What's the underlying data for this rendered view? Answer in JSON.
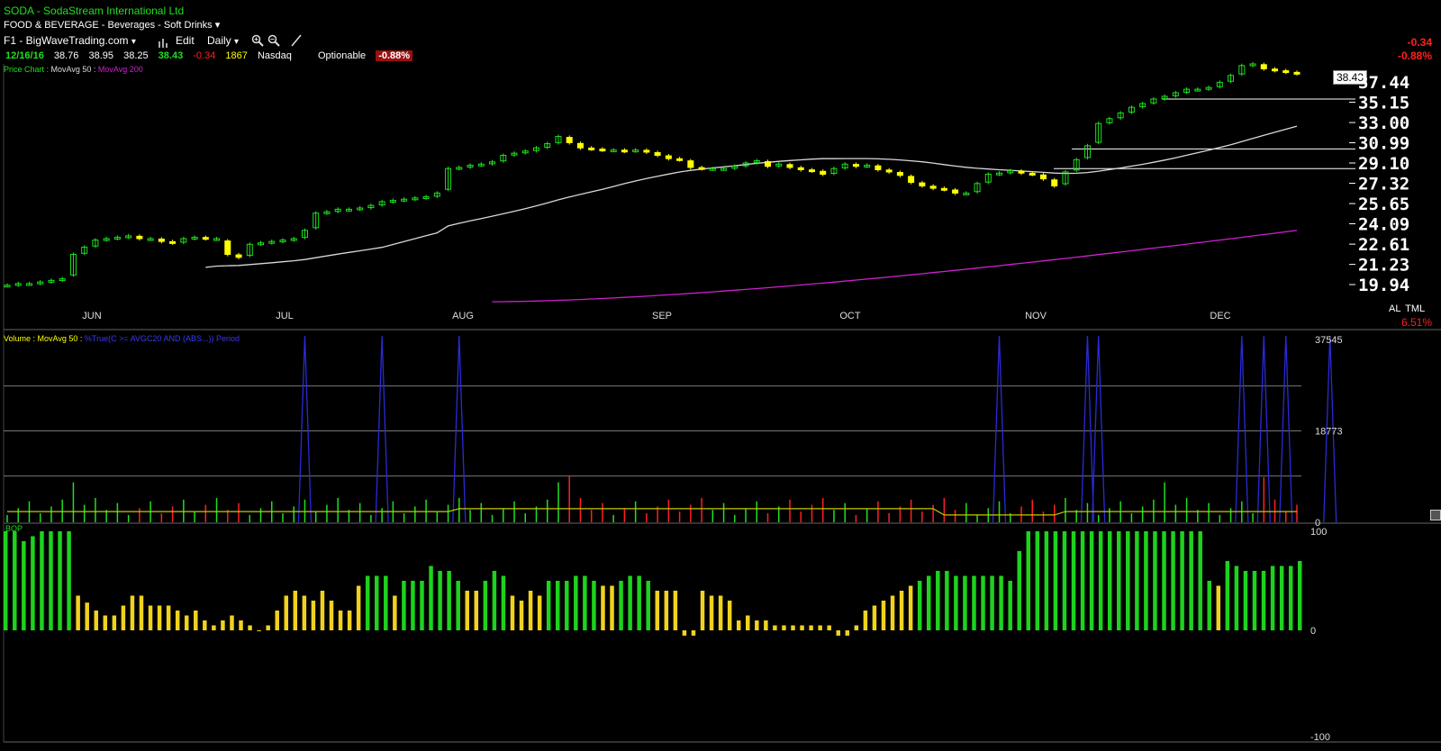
{
  "header": {
    "symbol": "SODA",
    "separator": " - ",
    "company": "SodaStream International Ltd",
    "sector": "FOOD & BEVERAGE - Beverages - Soft Drinks",
    "sector_caret": "▾",
    "layout": "F1 - BigWaveTrading.com",
    "layout_caret": "▾",
    "edit": "Edit",
    "period": "Daily",
    "period_caret": "▾"
  },
  "quote": {
    "date": "12/16/16",
    "open": "38.76",
    "high": "38.95",
    "low": "38.25",
    "close": "38.43",
    "change": "-0.34",
    "volume": "1867",
    "exchange": "Nasdaq",
    "optionable": "Optionable",
    "change_pct": "-0.88%"
  },
  "right_info": {
    "change": "-0.34",
    "change_pct": "-0.88%",
    "al": "AL",
    "tml": "TML",
    "pct": "6.51%"
  },
  "price_panel": {
    "legend_title": "Price Chart : ",
    "ma50_label": "MovAvg 50 : ",
    "ma200_label": "MovAvg 200",
    "last_price": "38.43"
  },
  "volume_panel": {
    "legend_title": "Volume : ",
    "ma_label": "MovAvg 50 : ",
    "custom_label": "%True(C >= AVGC20 AND (ABS...)) Period"
  },
  "bop_panel": {
    "legend": "BOP"
  },
  "colors": {
    "up": "#1ee01e",
    "down_yellow": "#ffff00",
    "ma50": "#d8d8d8",
    "ma200": "#cc22cc",
    "blue": "#2a2ad8",
    "volma": "#c8c800",
    "bop_green": "#1ed21e",
    "bop_yellow": "#f0d21e",
    "neg": "#ff2020"
  },
  "chart_data": [
    {
      "type": "candlestick",
      "title": "SODA - SodaStream International Ltd",
      "price_axis_ticks": [
        "37.44",
        "35.15",
        "33.00",
        "30.99",
        "29.10",
        "27.32",
        "25.65",
        "24.09",
        "22.61",
        "21.23",
        "19.94"
      ],
      "x_labels": [
        "JUN",
        "JUL",
        "AUG",
        "SEP",
        "OCT",
        "NOV",
        "DEC"
      ],
      "log_scale": true,
      "approx_closes": [
        19.9,
        20.0,
        20.0,
        20.1,
        20.2,
        20.3,
        21.9,
        22.4,
        22.9,
        23.0,
        23.1,
        23.2,
        23.0,
        23.0,
        22.8,
        22.7,
        23.0,
        23.1,
        23.0,
        23.0,
        21.9,
        21.7,
        22.6,
        22.7,
        22.8,
        22.9,
        23.0,
        23.6,
        24.9,
        25.0,
        25.2,
        25.2,
        25.3,
        25.5,
        25.8,
        25.9,
        26.0,
        26.1,
        26.2,
        26.5,
        28.6,
        28.7,
        28.9,
        29.0,
        29.2,
        29.8,
        30.0,
        30.2,
        30.5,
        30.9,
        31.6,
        31.0,
        30.5,
        30.4,
        30.3,
        30.3,
        30.2,
        30.3,
        30.1,
        29.8,
        29.5,
        29.4,
        28.7,
        28.6,
        28.6,
        28.6,
        28.8,
        29.1,
        29.3,
        28.8,
        29.0,
        28.7,
        28.5,
        28.4,
        28.1,
        28.6,
        29.0,
        28.8,
        28.9,
        28.5,
        28.3,
        28.0,
        27.4,
        27.1,
        26.9,
        26.8,
        26.5,
        26.5,
        27.3,
        28.1,
        28.2,
        28.4,
        28.2,
        28.1,
        27.7,
        27.1,
        28.3,
        29.4,
        30.7,
        32.9,
        33.4,
        34.0,
        34.6,
        35.0,
        35.5,
        35.8,
        36.2,
        36.6,
        36.6,
        36.8,
        37.4,
        38.2,
        39.4,
        39.6,
        39.0,
        38.8,
        38.6,
        38.43
      ]
    },
    {
      "type": "bar",
      "title": "Volume",
      "y_ticks": [
        "37545",
        "18773",
        "0"
      ]
    },
    {
      "type": "bar",
      "title": "BOP",
      "y_ticks": [
        "100",
        "0",
        "-100"
      ],
      "values": [
        100,
        100,
        90,
        95,
        100,
        100,
        100,
        100,
        35,
        28,
        20,
        15,
        15,
        25,
        35,
        35,
        25,
        25,
        25,
        20,
        15,
        20,
        10,
        5,
        10,
        15,
        10,
        5,
        0,
        5,
        20,
        35,
        40,
        35,
        30,
        40,
        30,
        20,
        20,
        45,
        55,
        55,
        55,
        35,
        50,
        50,
        50,
        65,
        60,
        60,
        50,
        40,
        40,
        50,
        60,
        55,
        35,
        30,
        40,
        35,
        50,
        50,
        50,
        55,
        55,
        50,
        45,
        45,
        50,
        55,
        55,
        50,
        40,
        40,
        40,
        -5,
        -5,
        40,
        35,
        35,
        30,
        10,
        15,
        10,
        10,
        5,
        5,
        5,
        5,
        5,
        5,
        5,
        -5,
        -5,
        5,
        20,
        25,
        30,
        35,
        40,
        45,
        50,
        55,
        60,
        60,
        55,
        55,
        55,
        55,
        55,
        55,
        50,
        80,
        100,
        100,
        100,
        100,
        100,
        100,
        100,
        100,
        100,
        100,
        100,
        100,
        100,
        100,
        100,
        100,
        100,
        100,
        100,
        100,
        50,
        45,
        70,
        65,
        60,
        60,
        60,
        65,
        65,
        65,
        70
      ]
    }
  ]
}
